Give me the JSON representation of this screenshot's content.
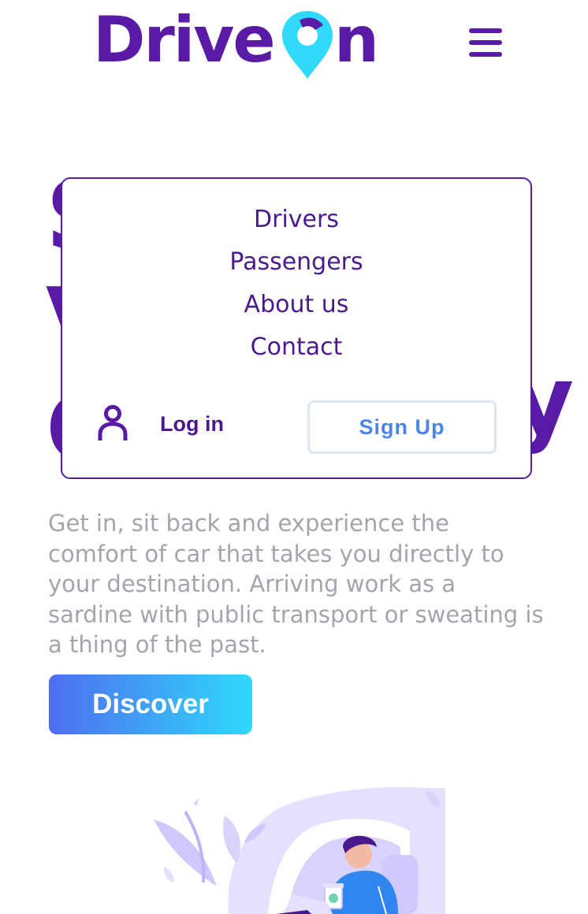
{
  "brand": {
    "logo_text_left": "Drive",
    "logo_text_right": "n",
    "primary_color": "#5b1aa6",
    "pin_color": "#2fd9fb"
  },
  "header": {
    "menu_icon": "hamburger-icon"
  },
  "hero": {
    "background_fragment": "S\nV\nC",
    "background_tail": "y",
    "paragraph": "Get in, sit back and experience the comfort of car that takes you directly to your destination. Arriving work as a sardine with public transport or sweating is a thing of the past.",
    "cta_label": "Discover"
  },
  "menu": {
    "items": [
      {
        "label": "Drivers"
      },
      {
        "label": "Passengers"
      },
      {
        "label": "About us"
      },
      {
        "label": "Contact"
      }
    ],
    "login_label": "Log in",
    "signup_label": "Sign Up",
    "user_icon": "user-icon"
  },
  "illustration": {
    "icon": "car-passenger-illustration"
  }
}
